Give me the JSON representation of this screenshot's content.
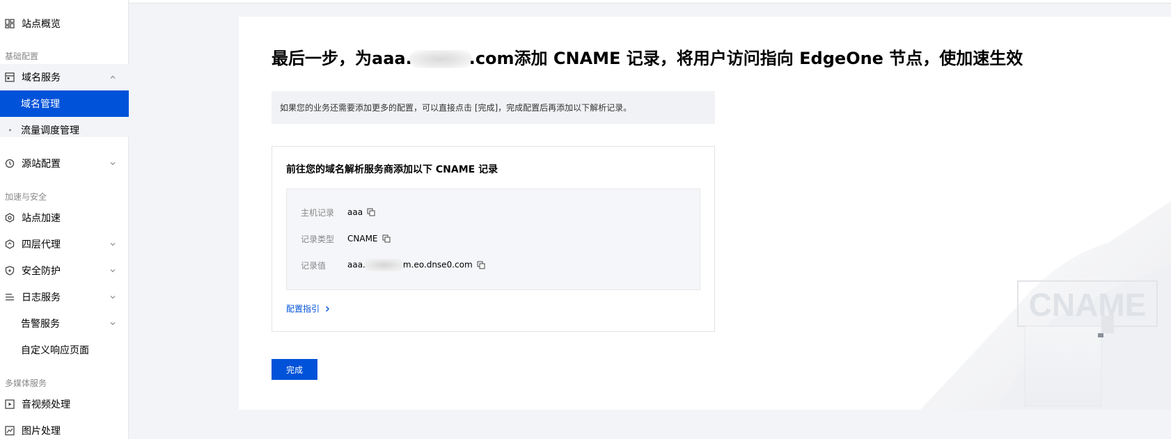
{
  "sidebar": {
    "overview": "站点概览",
    "section_basic": "基础配置",
    "domain_service": "域名服务",
    "domain_manage": "域名管理",
    "traffic_schedule": "流量调度管理",
    "origin_config": "源站配置",
    "section_accel": "加速与安全",
    "site_accel": "站点加速",
    "l4_proxy": "四层代理",
    "security": "安全防护",
    "log_service": "日志服务",
    "alarm_service": "告警服务",
    "custom_page": "自定义响应页面",
    "section_media": "多媒体服务",
    "av_process": "音视频处理",
    "image_process": "图片处理"
  },
  "main": {
    "title_prefix": "最后一步，为aaa.",
    "title_suffix": ".com添加 CNAME 记录，将用户访问指向 EdgeOne 节点，使加速生效",
    "info_text": "如果您的业务还需要添加更多的配置，可以直接点击 [完成]，完成配置后再添加以下解析记录。",
    "record_title": "前往您的域名解析服务商添加以下 CNAME 记录",
    "records": [
      {
        "key": "主机记录",
        "value": "aaa"
      },
      {
        "key": "记录类型",
        "value": "CNAME"
      },
      {
        "key": "记录值",
        "value_prefix": "aaa.",
        "value_suffix": "m.eo.dnse0.com"
      }
    ],
    "guide_link": "配置指引",
    "done_button": "完成",
    "decor_text": "CNAME"
  },
  "colors": {
    "accent": "#0052d9",
    "background": "#f3f4f7"
  }
}
